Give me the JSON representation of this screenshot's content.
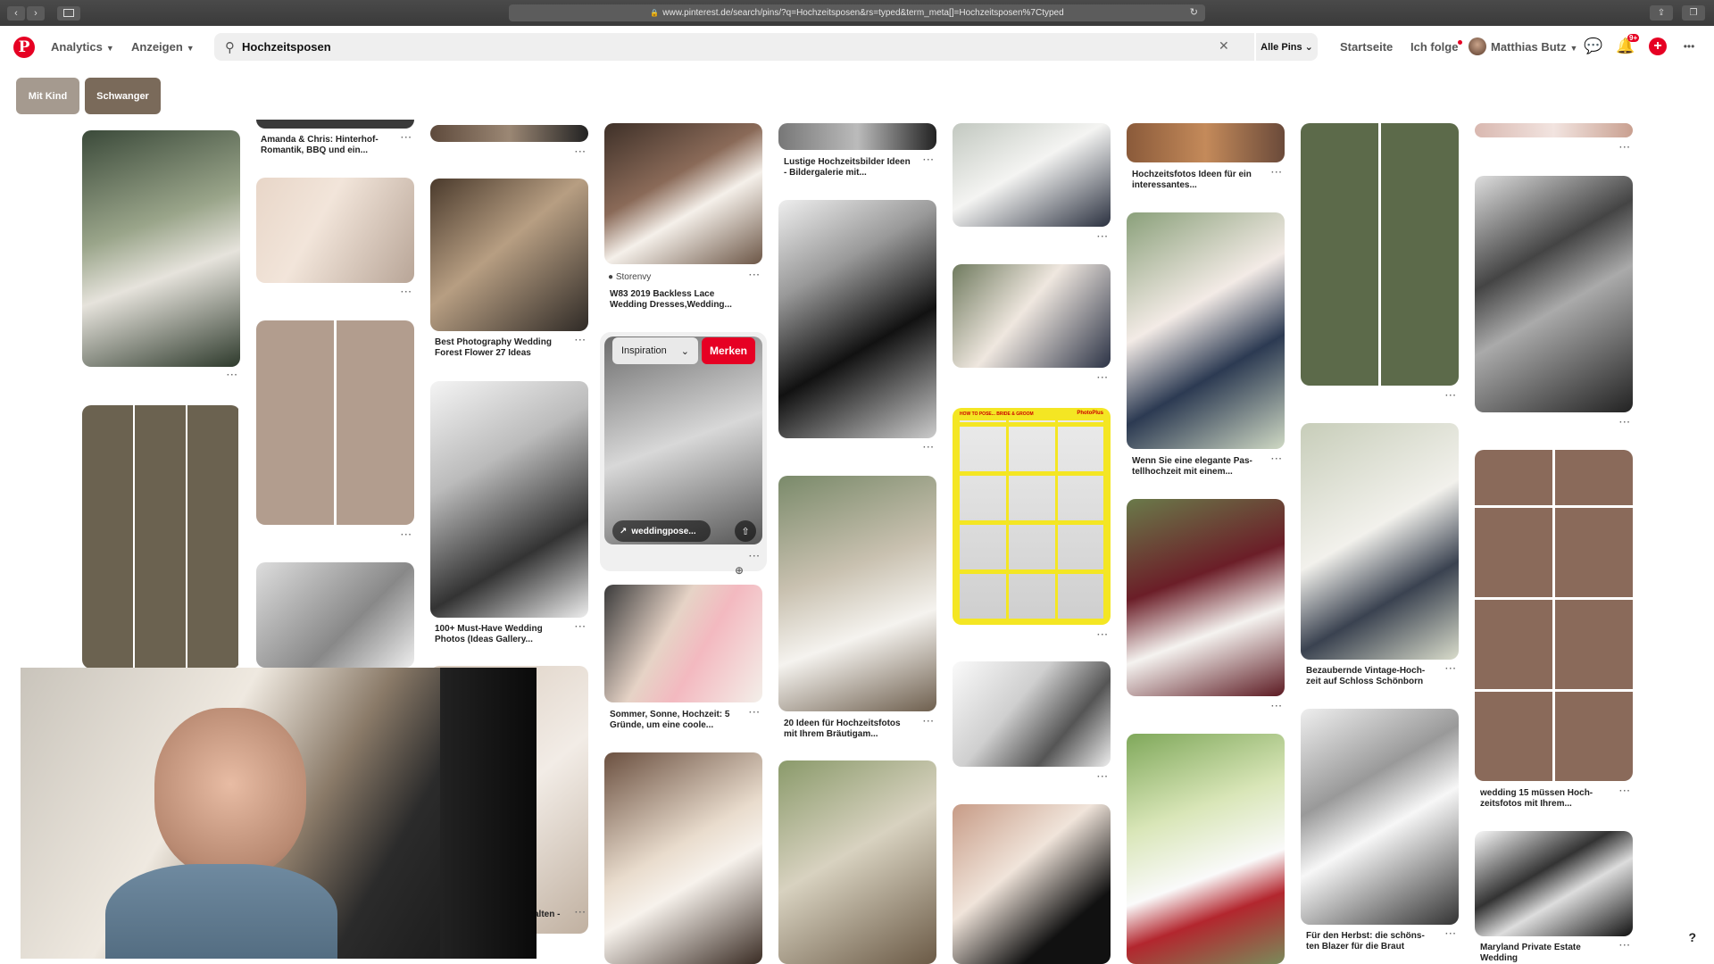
{
  "browser": {
    "url": "www.pinterest.de/search/pins/?q=Hochzeitsposen&rs=typed&term_meta[]=Hochzeitsposen%7Ctyped"
  },
  "header": {
    "logo": "P",
    "analytics_label": "Analytics",
    "ads_label": "Anzeigen",
    "search_value": "Hochzeitsposen",
    "search_scope": "Alle Pins",
    "home_label": "Startseite",
    "following_label": "Ich folge",
    "user_name": "Matthias Butz",
    "notification_count": "9+",
    "more_label": "•••"
  },
  "chips": [
    "Mit Kind",
    "Schwanger"
  ],
  "overlay": {
    "board_select": "Inspiration",
    "save_label": "Merken",
    "source": "weddingpose...",
    "source_label": "Storenvy"
  },
  "pins": [
    {
      "title": "Amanda & Chris: Hinterhof-",
      "title2": "Romantik, BBQ und ein..."
    },
    {
      "title": "Best Photography Wedding",
      "title2": "Forest Flower 27 Ideas"
    },
    {
      "title": "100+ Must-Have Wedding",
      "title2": "Photos (Ideas Gallery..."
    },
    {
      "title": "W83 2019 Backless Lace",
      "title2": "Wedding Dresses,Wedding..."
    },
    {
      "title": "Sommer, Sonne, Hochzeit: 5",
      "title2": "Gründe, um eine coole..."
    },
    {
      "title": "Lustige Hochzeitsbilder Ideen",
      "title2": "- Bildergalerie mit..."
    },
    {
      "title": "20 Ideen für Hochzeitsfotos",
      "title2": "mit Ihrem Bräutigam..."
    },
    {
      "title": "Hochzeitsfotos Ideen für ein",
      "title2": "interessantes..."
    },
    {
      "title": "Wenn Sie eine elegante Pas-",
      "title2": "tellhochzeit mit einem..."
    },
    {
      "title": "Bezaubernde Vintage-Hoch-",
      "title2": "zeit auf Schloss Schönborn"
    },
    {
      "title": "Für den Herbst: die schöns-",
      "title2": "ten Blazer für die Braut"
    },
    {
      "title": "wedding 15 müssen Hoch-",
      "title2": "zeitsfotos mit Ihrem..."
    },
    {
      "title": "Maryland Private Estate",
      "title2": "Wedding"
    },
    {
      "title": "alten -",
      "title2": ""
    }
  ],
  "poster": {
    "title": "HOW TO POSE... BRIDE & GROOM",
    "brand": "PhotoPlus"
  },
  "help_label": "?",
  "colors": {
    "brand": "#e60023",
    "chip_dark": "#7a6a5a",
    "chip_light": "#a59a8f"
  }
}
